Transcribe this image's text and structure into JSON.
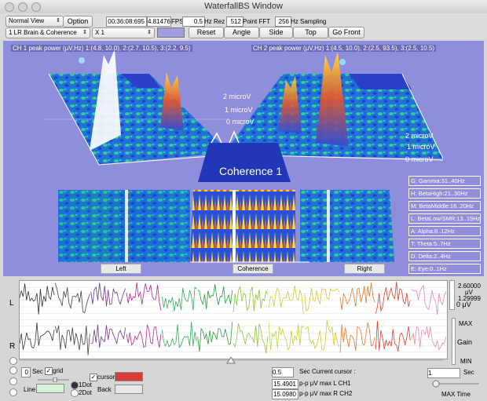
{
  "window": {
    "title": "WaterfallBS Window"
  },
  "toolbar": {
    "view_select": "Normal View",
    "option_label": "Option",
    "time": "00:36:08:695",
    "fps_value": "4.81476",
    "fps_label": "FPS",
    "hz_rez_value": "0.5",
    "hz_rez_label": "Hz Rez",
    "point_fft_value": "512",
    "point_fft_label": "Point FFT",
    "hz_sampling_value": "256",
    "hz_sampling_label": "Hz Sampling",
    "mode_select": "1 LR Brain & Coherence",
    "scale_select": "X 1",
    "reset_label": "Reset",
    "angle_label": "Angle",
    "side_label": "Side",
    "top_label": "Top",
    "gofront_label": "Go Front"
  },
  "viz": {
    "ch1_peak": "CH 1 peak power (μV,Hz) 1:(4.8, 10.0), 2:(2.7, 10.5), 3:(2.2, 9.5)",
    "ch2_peak": "CH 2 peak power (μV,Hz) 1:(4.5, 10.0), 2:(2.5, 93.5), 3:(2.5, 10.5)",
    "coherence_title": "Coherence 1",
    "left_label": "Left",
    "coherence_label": "Coherence",
    "right_label": "Right",
    "left_micro": [
      "2 microV",
      "1 microV",
      "0 microV"
    ],
    "right_micro": [
      "2 microV",
      "1 microV",
      "0 microV"
    ],
    "bands": [
      "G: Gamma:31..40Hz",
      "H: BetaHigh:21..30Hz",
      "M: BetaMiddle:16..20Hz",
      "L: BetaLow/SMR:13..15Hz",
      "A: Alpha:8..12Hz",
      "T: Theta:5..7Hz",
      "D: Delta:2..4Hz",
      "E: Eye:0..1Hz"
    ]
  },
  "wave": {
    "L_label": "L",
    "R_label": "R",
    "top_value": "2.60000",
    "unit": "μV",
    "bottom_value": "1.29999",
    "zero_label": "0 μV"
  },
  "right_panel": {
    "max_label": "MAX",
    "gain_label": "Gain",
    "min_label": "MIN",
    "sec_value": "1",
    "sec_label": "Sec",
    "max_time_label": "MAX Time"
  },
  "bottom": {
    "sec_value": "0",
    "sec_label": "Sec",
    "grid_label": "grid",
    "line_label": "Line",
    "dot1_label": "1Dot",
    "dot2_label": "2Dot",
    "cursor_label": "cursor",
    "back_label": "Back",
    "cursor_value": "0.5",
    "cursor_sec_label": "Sec Current cursor :",
    "ch1_value": "15.4901",
    "ch1_label": "p-p μV max L CH1",
    "ch2_value": "15.0980",
    "ch2_label": "p-p μV max R CH2"
  },
  "colors": {
    "viz_bg": "#8e8edc",
    "cursor_color": "#d93a3a",
    "line_color": "#d4f2d4"
  }
}
